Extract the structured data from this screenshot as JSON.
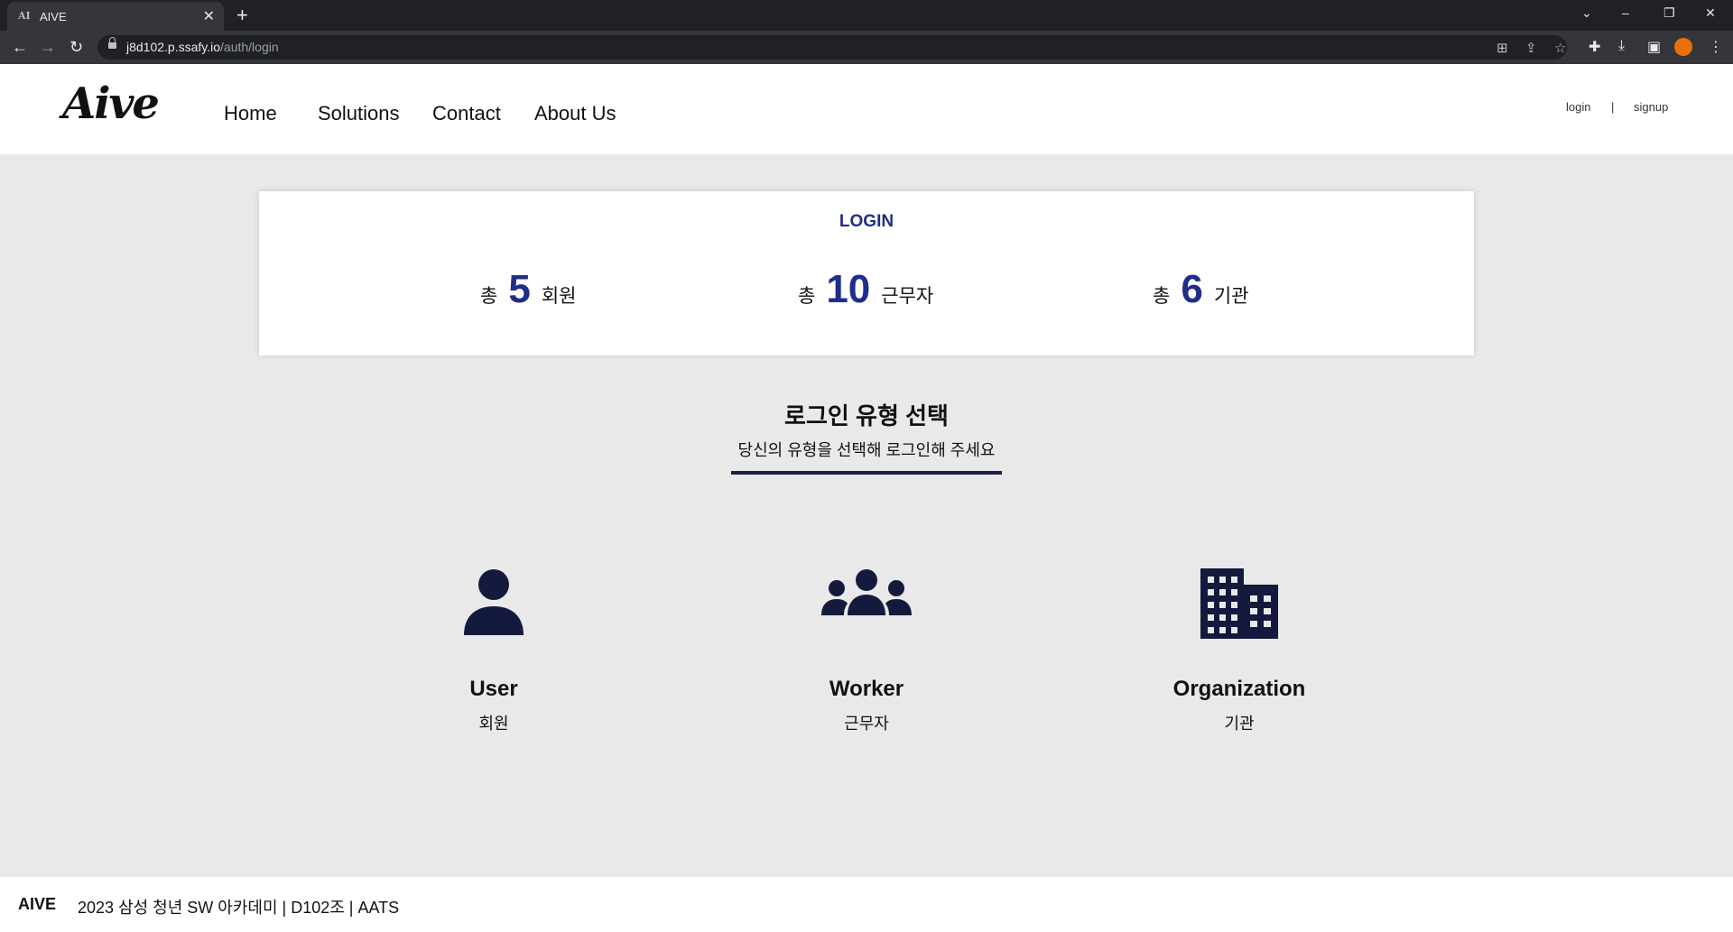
{
  "browser": {
    "tab_title": "AIVE",
    "tab_favicon": "AI",
    "url_host": "j8d102.p.ssafy.io",
    "url_path": "/auth/login"
  },
  "header": {
    "logo": "Aive",
    "nav": [
      "Home",
      "Solutions",
      "Contact",
      "About Us"
    ],
    "login": "login",
    "separator": "|",
    "signup": "signup"
  },
  "stats": {
    "title": "LOGIN",
    "items": [
      {
        "pre": "총",
        "num": "5",
        "post": "회원"
      },
      {
        "pre": "총",
        "num": "10",
        "post": "근무자"
      },
      {
        "pre": "총",
        "num": "6",
        "post": "기관"
      }
    ]
  },
  "selection": {
    "title": "로그인 유형 선택",
    "subtitle": "당신의 유형을 선택해 로그인해 주세요",
    "roles": [
      {
        "icon": "user-icon",
        "name": "User",
        "kr": "회원"
      },
      {
        "icon": "users-group-icon",
        "name": "Worker",
        "kr": "근무자"
      },
      {
        "icon": "building-icon",
        "name": "Organization",
        "kr": "기관"
      }
    ]
  },
  "footer": {
    "brand": "AIVE",
    "info": "2023 삼성 청년 SW 아카데미 | D102조 | AATS"
  },
  "colors": {
    "accent": "#1f2e8a",
    "icon": "#141a3d",
    "page_bg": "#e9e9e9"
  }
}
